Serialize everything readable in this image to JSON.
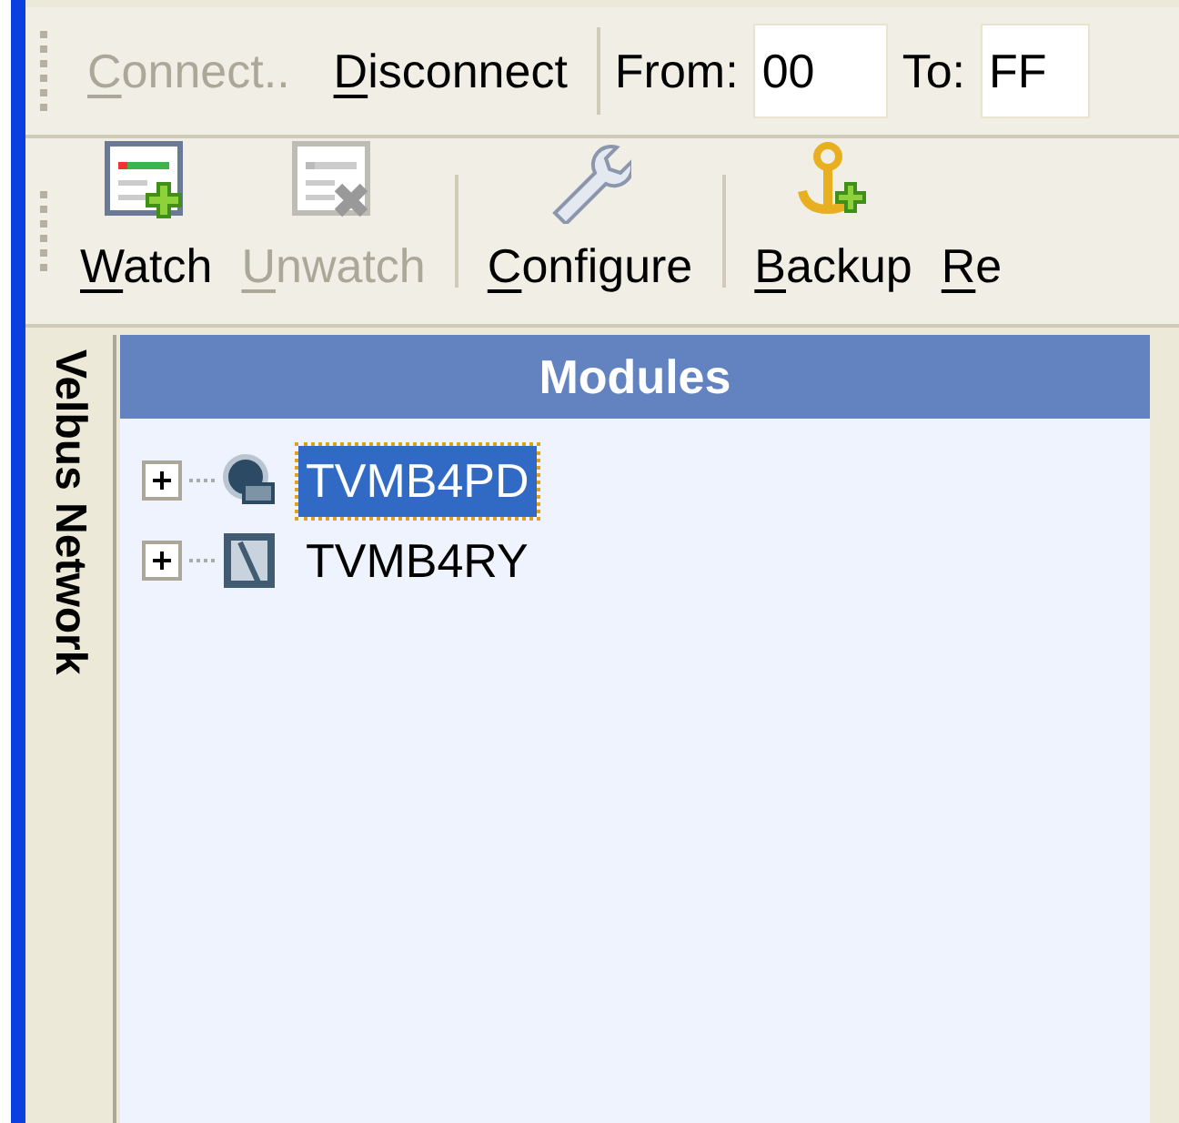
{
  "connection_toolbar": {
    "buttons": [
      {
        "access_key": "C",
        "label_rest": "onnect..",
        "disabled": true
      },
      {
        "access_key": "D",
        "label_rest": "isconnect",
        "disabled": false
      }
    ],
    "from": {
      "label": "From:",
      "value": "00"
    },
    "to": {
      "label": "To:",
      "value": "FF"
    }
  },
  "main_toolbar": {
    "buttons": [
      {
        "kind": "watch",
        "access_key": "W",
        "label_rest": "atch",
        "disabled": false,
        "separator_before": false
      },
      {
        "kind": "unwatch",
        "access_key": "U",
        "label_rest": "nwatch",
        "disabled": true,
        "separator_before": false
      },
      {
        "kind": "configure",
        "access_key": "C",
        "label_rest": "onfigure",
        "disabled": false,
        "separator_before": true
      },
      {
        "kind": "backup",
        "access_key": "B",
        "label_rest": "ackup",
        "disabled": false,
        "separator_before": true
      },
      {
        "kind": "none",
        "access_key": "R",
        "label_rest": "e",
        "disabled": false,
        "separator_before": false
      }
    ]
  },
  "side_tab": {
    "label": "Velbus Network"
  },
  "modules": {
    "title": "Modules",
    "items": [
      {
        "kind": "dimmer",
        "label": "TVMB4PD",
        "selected": true,
        "expanded": false
      },
      {
        "kind": "relay",
        "label": "TVMB4RY",
        "selected": false,
        "expanded": false
      }
    ]
  }
}
